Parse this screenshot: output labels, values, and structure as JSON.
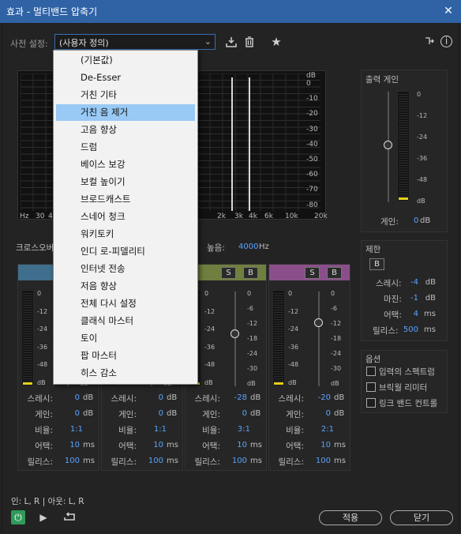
{
  "window": {
    "title": "효과 - 멀티밴드 압축기",
    "close_glyph": "✕"
  },
  "preset": {
    "label": "사전 설정:",
    "value": "(사용자 정의)"
  },
  "dropdown": {
    "options": [
      "(기본값)",
      "De-Esser",
      "거친 기타",
      "거친 음 제거",
      "고음 향상",
      "드럼",
      "베이스 보강",
      "보컬 높이기",
      "브로드캐스트",
      "스네어 청크",
      "워키토키",
      "인디 로-피델리티",
      "인터넷 전송",
      "저음 향상",
      "전체 다시 설정",
      "클래식 마스터",
      "토이",
      "팝 마스터",
      "히스 감소"
    ],
    "selected_index": 3
  },
  "graph": {
    "db_unit": "dB",
    "db_ticks": [
      "0",
      "-10",
      "-20",
      "-30",
      "-40",
      "-50",
      "-60",
      "-70",
      "-80"
    ],
    "freq_ticks": [
      "Hz",
      "30",
      "4",
      "2k",
      "3k",
      "4k",
      "6k",
      "10k",
      "20k"
    ]
  },
  "crossover": {
    "label": "크로스오버",
    "high_label": "높음:",
    "high_value": "4000",
    "high_unit": "Hz"
  },
  "output_gain": {
    "title": "출력 게인",
    "gain_label": "게인:",
    "gain_value": "0",
    "gain_unit": "dB",
    "meter_ticks": [
      "0",
      "-12",
      "-24",
      "-36",
      "-48",
      "dB"
    ]
  },
  "limit": {
    "title": "제한",
    "b_label": "B",
    "rows": [
      {
        "label": "스레시:",
        "value": "-4",
        "unit": "dB"
      },
      {
        "label": "마진:",
        "value": "-1",
        "unit": "dB"
      },
      {
        "label": "어택:",
        "value": "4",
        "unit": "ms"
      },
      {
        "label": "릴리스:",
        "value": "500",
        "unit": "ms"
      }
    ]
  },
  "options": {
    "title": "옵션",
    "items": [
      "입력의 스펙트럼",
      "브릭월 리미터",
      "링크 밴드 컨트롤"
    ]
  },
  "band_labels": {
    "thresh": "스레시:",
    "gain": "게인:",
    "ratio": "비율:",
    "attack": "어택:",
    "release": "릴리스:",
    "s": "S",
    "b": "B"
  },
  "meter_ticks": [
    "0",
    "-12",
    "-24",
    "-36",
    "-48",
    "dB"
  ],
  "slider_ticks": [
    "0",
    "-6",
    "-12",
    "-18",
    "-24",
    "-30",
    "dB"
  ],
  "bands": [
    {
      "thresh": "0",
      "gain": "0",
      "ratio": "1:1",
      "attack": "10",
      "release": "100",
      "db": "dB",
      "ms": "ms",
      "color": "#3f6f8c"
    },
    {
      "thresh": "0",
      "gain": "0",
      "ratio": "1:1",
      "attack": "10",
      "release": "100",
      "db": "dB",
      "ms": "ms",
      "color": "#5a7a3a"
    },
    {
      "thresh": "-28",
      "gain": "0",
      "ratio": "3:1",
      "attack": "10",
      "release": "100",
      "db": "dB",
      "ms": "ms",
      "color": "#6f7f3f"
    },
    {
      "thresh": "-20",
      "gain": "0",
      "ratio": "2:1",
      "attack": "10",
      "release": "100",
      "db": "dB",
      "ms": "ms",
      "color": "#8a4f8a"
    }
  ],
  "footer": {
    "io": "인: L, R | 아웃: L, R",
    "apply": "적용",
    "close": "닫기"
  }
}
